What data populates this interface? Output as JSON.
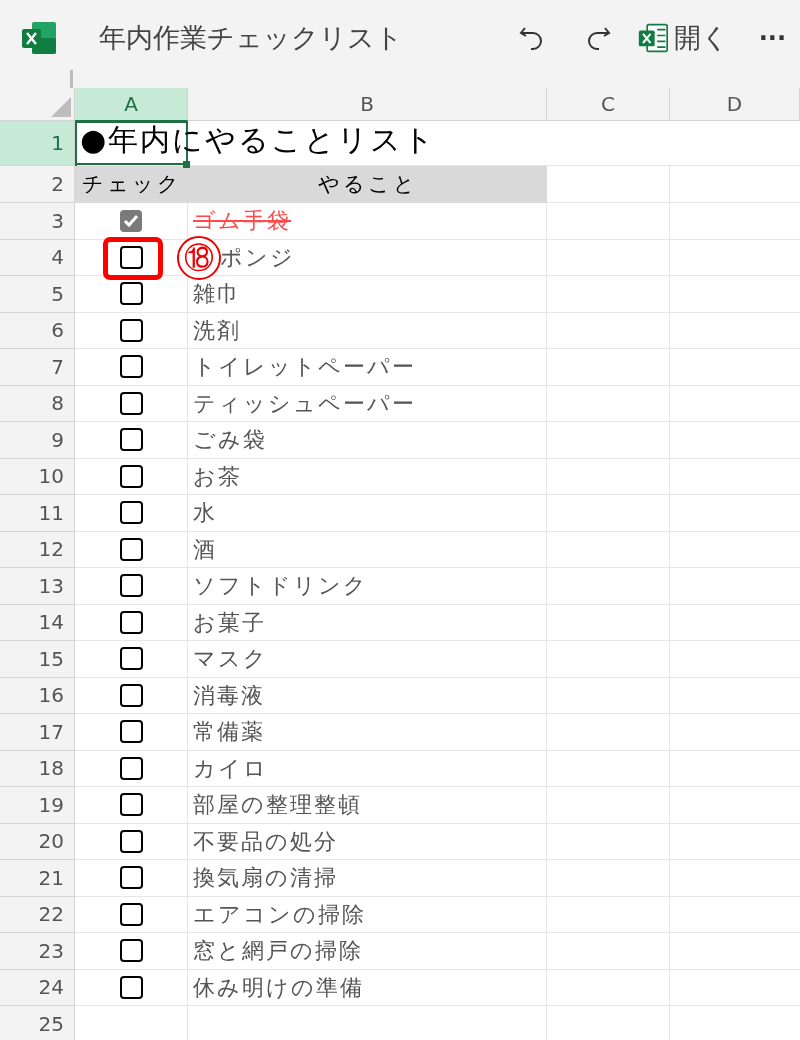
{
  "toolbar": {
    "title": "年内作業チェックリスト",
    "open_label": "開く",
    "more_label": "···"
  },
  "column_headers": [
    {
      "label": "A",
      "selected": true
    },
    {
      "label": "B",
      "selected": false
    },
    {
      "label": "C",
      "selected": false
    },
    {
      "label": "D",
      "selected": false
    }
  ],
  "sheet": {
    "title_row": {
      "number": "1",
      "selected": true,
      "text": "●年内にやることリスト"
    },
    "header_row": {
      "number": "2",
      "selected": false,
      "cells": [
        "チェック",
        "やること"
      ]
    },
    "items": [
      {
        "number": "3",
        "checked": true,
        "highlighted": false,
        "text": "ゴム手袋"
      },
      {
        "number": "4",
        "checked": false,
        "highlighted": true,
        "callout": "⑱",
        "text": "ポンジ"
      },
      {
        "number": "5",
        "checked": false,
        "highlighted": false,
        "text": "雑巾"
      },
      {
        "number": "6",
        "checked": false,
        "highlighted": false,
        "text": "洗剤"
      },
      {
        "number": "7",
        "checked": false,
        "highlighted": false,
        "text": "トイレットペーパー"
      },
      {
        "number": "8",
        "checked": false,
        "highlighted": false,
        "text": "ティッシュペーパー"
      },
      {
        "number": "9",
        "checked": false,
        "highlighted": false,
        "text": "ごみ袋"
      },
      {
        "number": "10",
        "checked": false,
        "highlighted": false,
        "text": "お茶"
      },
      {
        "number": "11",
        "checked": false,
        "highlighted": false,
        "text": "水"
      },
      {
        "number": "12",
        "checked": false,
        "highlighted": false,
        "text": "酒"
      },
      {
        "number": "13",
        "checked": false,
        "highlighted": false,
        "text": "ソフトドリンク"
      },
      {
        "number": "14",
        "checked": false,
        "highlighted": false,
        "text": "お菓子"
      },
      {
        "number": "15",
        "checked": false,
        "highlighted": false,
        "text": "マスク"
      },
      {
        "number": "16",
        "checked": false,
        "highlighted": false,
        "text": "消毒液"
      },
      {
        "number": "17",
        "checked": false,
        "highlighted": false,
        "text": "常備薬"
      },
      {
        "number": "18",
        "checked": false,
        "highlighted": false,
        "text": "カイロ"
      },
      {
        "number": "19",
        "checked": false,
        "highlighted": false,
        "text": "部屋の整理整頓"
      },
      {
        "number": "20",
        "checked": false,
        "highlighted": false,
        "text": "不要品の処分"
      },
      {
        "number": "21",
        "checked": false,
        "highlighted": false,
        "text": "換気扇の清掃"
      },
      {
        "number": "22",
        "checked": false,
        "highlighted": false,
        "text": "エアコンの掃除"
      },
      {
        "number": "23",
        "checked": false,
        "highlighted": false,
        "text": "窓と網戸の掃除"
      },
      {
        "number": "24",
        "checked": false,
        "highlighted": false,
        "text": "休み明けの準備"
      }
    ],
    "empty_rows": [
      {
        "number": "25",
        "selected": false
      }
    ]
  }
}
